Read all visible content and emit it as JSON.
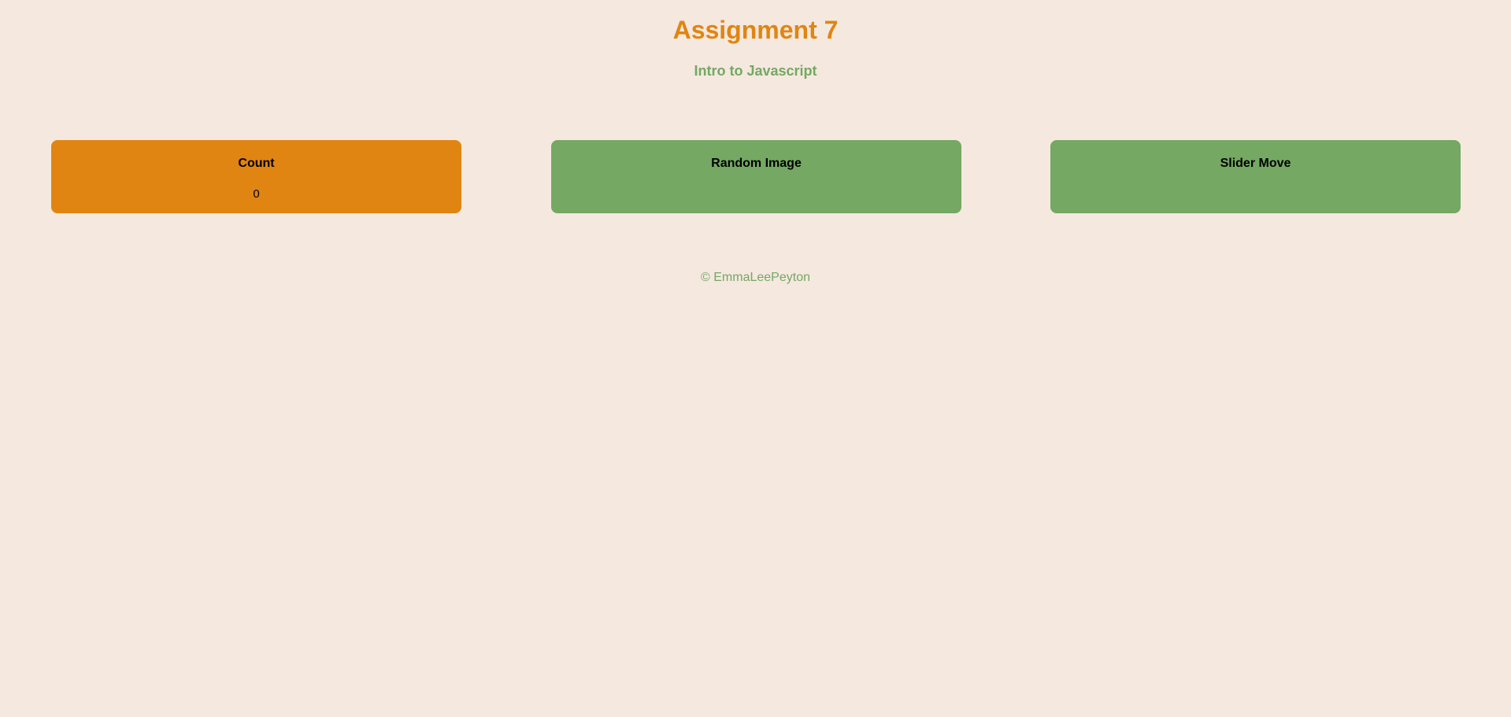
{
  "header": {
    "title": "Assignment 7",
    "subtitle": "Intro to Javascript"
  },
  "cards": [
    {
      "title": "Count",
      "value": "0",
      "color": "#e08512"
    },
    {
      "title": "Random Image",
      "color": "#74a863"
    },
    {
      "title": "Slider Move",
      "color": "#74a863"
    }
  ],
  "footer": {
    "text": "© EmmaLeePeyton"
  },
  "colors": {
    "background": "#f5e8df",
    "accent_orange": "#e08512",
    "accent_green": "#74a863"
  }
}
